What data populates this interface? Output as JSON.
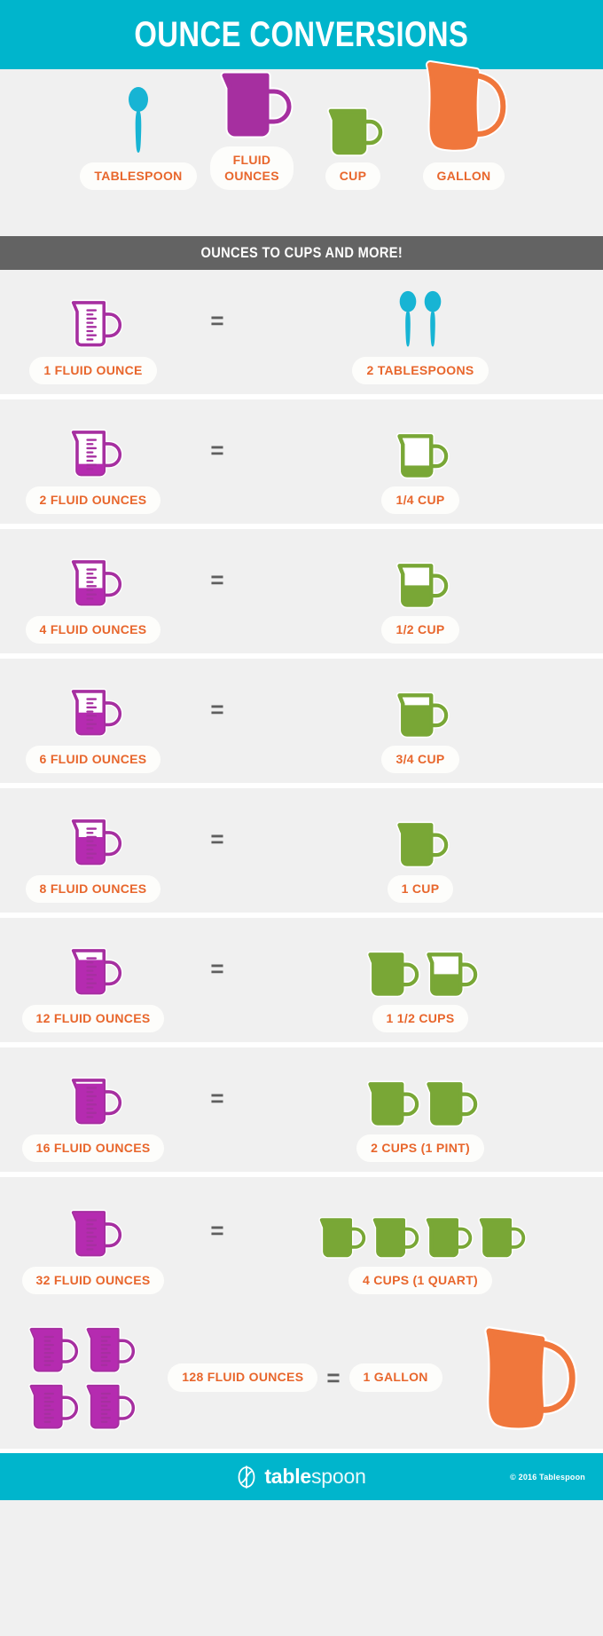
{
  "header": {
    "title": "OUNCE CONVERSIONS",
    "background_color": "#00b5cc"
  },
  "hero": {
    "items": [
      {
        "label": "TABLESPOON",
        "icon": "spoon-icon",
        "color": "#17b4d4"
      },
      {
        "label": "FLUID\nOUNCES",
        "icon": "measuring-cup-icon",
        "color": "#a62fa0"
      },
      {
        "label": "CUP",
        "icon": "cup-icon",
        "color": "#79a736"
      },
      {
        "label": "GALLON",
        "icon": "pitcher-icon",
        "color": "#f0773c"
      }
    ]
  },
  "section": {
    "title": "OUNCES TO CUPS AND MORE!",
    "background_color": "#636363"
  },
  "conversions": {
    "equals_symbol": "=",
    "rows": [
      {
        "left_label": "1 FLUID OUNCE",
        "right_label": "2 TABLESPOONS",
        "left_icon": "measuring-cup-icon",
        "left_fill": 0,
        "right_icon": "spoon-icon",
        "right_count": 2,
        "right_fills": []
      },
      {
        "left_label": "2 FLUID OUNCES",
        "right_label": "1/4 CUP",
        "left_icon": "measuring-cup-icon",
        "left_fill": 25,
        "right_icon": "cup-icon",
        "right_count": 1,
        "right_fills": [
          25
        ]
      },
      {
        "left_label": "4 FLUID OUNCES",
        "right_label": "1/2 CUP",
        "left_icon": "measuring-cup-icon",
        "left_fill": 38,
        "right_icon": "cup-icon",
        "right_count": 1,
        "right_fills": [
          50
        ]
      },
      {
        "left_label": "6 FLUID OUNCES",
        "right_label": "3/4 CUP",
        "left_icon": "measuring-cup-icon",
        "left_fill": 50,
        "right_icon": "cup-icon",
        "right_count": 1,
        "right_fills": [
          75
        ]
      },
      {
        "left_label": "8 FLUID OUNCES",
        "right_label": "1 CUP",
        "left_icon": "measuring-cup-icon",
        "left_fill": 62,
        "right_icon": "cup-icon",
        "right_count": 1,
        "right_fills": [
          100
        ]
      },
      {
        "left_label": "12 FLUID OUNCES",
        "right_label": "1 1/2 CUPS",
        "left_icon": "measuring-cup-icon",
        "left_fill": 78,
        "right_icon": "cup-icon",
        "right_count": 2,
        "right_fills": [
          100,
          50
        ]
      },
      {
        "left_label": "16 FLUID OUNCES",
        "right_label": "2 CUPS (1 PINT)",
        "left_icon": "measuring-cup-icon",
        "left_fill": 92,
        "right_icon": "cup-icon",
        "right_count": 2,
        "right_fills": [
          100,
          100
        ]
      },
      {
        "left_label": "32 FLUID OUNCES",
        "right_label": "4 CUPS (1 QUART)",
        "left_icon": "measuring-cup-icon",
        "left_fill": 100,
        "right_icon": "cup-icon",
        "right_count": 4,
        "right_fills": [
          100,
          100,
          100,
          100
        ]
      }
    ]
  },
  "gallon_row": {
    "left_icon": "measuring-cup-icon",
    "left_icon_count": 4,
    "left_label": "128 FLUID OUNCES",
    "equals_symbol": "=",
    "right_label": "1 GALLON",
    "right_icon": "pitcher-icon"
  },
  "footer": {
    "brand_bold": "table",
    "brand_light": "spoon",
    "logo_icon": "tablespoon-logo-icon",
    "copyright": "© 2016 Tablespoon",
    "background_color": "#00b5cc"
  },
  "colors": {
    "teal": "#00b5cc",
    "spoon_blue": "#17b4d4",
    "purple": "#a62fa0",
    "green": "#79a736",
    "orange_icon": "#f0773c",
    "orange_text": "#e8662c",
    "gray_bar": "#636363",
    "page_bg": "#f0f0f0",
    "pill_bg": "#fdfdfb"
  }
}
